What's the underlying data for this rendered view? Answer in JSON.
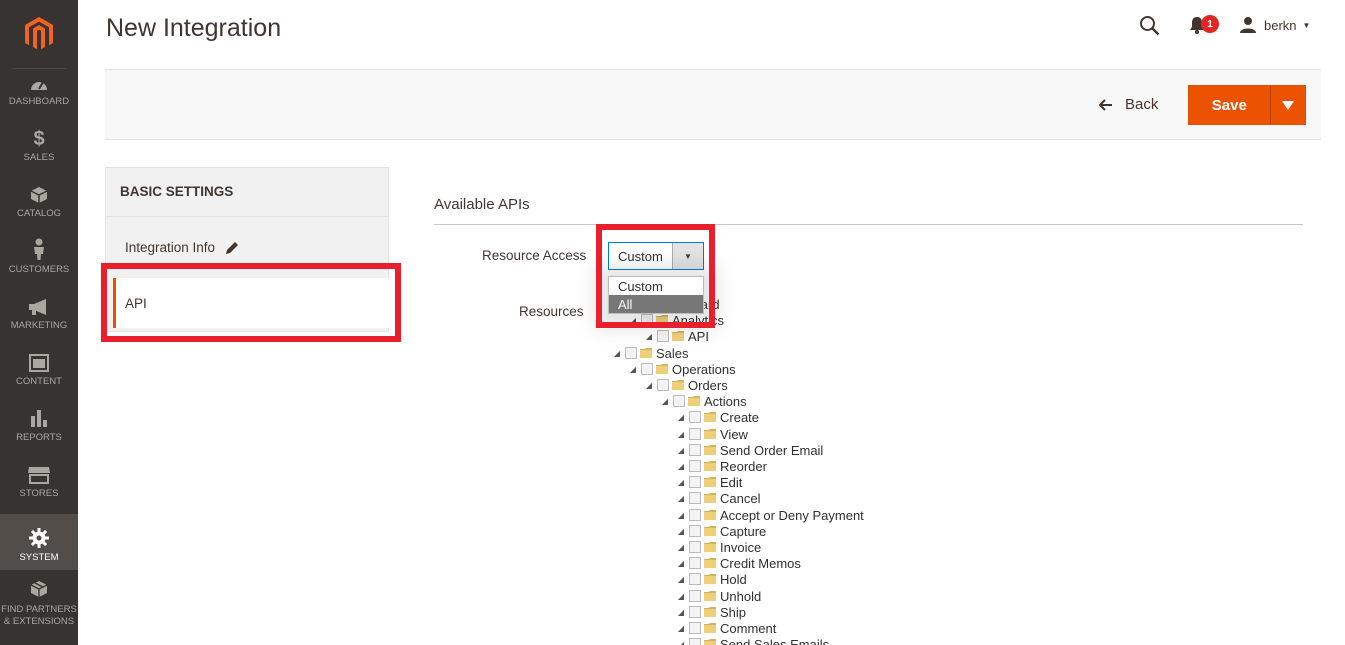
{
  "nav": {
    "items": [
      {
        "label": "DASHBOARD",
        "icon": "dashboard-icon"
      },
      {
        "label": "SALES",
        "icon": "dollar-icon"
      },
      {
        "label": "CATALOG",
        "icon": "cube-icon"
      },
      {
        "label": "CUSTOMERS",
        "icon": "person-icon"
      },
      {
        "label": "MARKETING",
        "icon": "megaphone-icon"
      },
      {
        "label": "CONTENT",
        "icon": "layout-icon"
      },
      {
        "label": "REPORTS",
        "icon": "bar-chart-icon"
      },
      {
        "label": "STORES",
        "icon": "store-icon"
      },
      {
        "label": "SYSTEM",
        "icon": "gear-icon"
      },
      {
        "label": "FIND PARTNERS & EXTENSIONS",
        "icon": "boxes-icon"
      }
    ]
  },
  "header": {
    "title": "New Integration",
    "notification_count": "1",
    "username": "berkn"
  },
  "actions": {
    "back_label": "Back",
    "save_label": "Save"
  },
  "tabs": {
    "title": "BASIC SETTINGS",
    "items": [
      {
        "label": "Integration Info"
      },
      {
        "label": "API"
      }
    ]
  },
  "content": {
    "section_title": "Available APIs",
    "resource_access_label": "Resource Access",
    "resource_access_value": "Custom",
    "dropdown_options": [
      "Custom",
      "All"
    ],
    "resources_label": "Resources",
    "tree": [
      {
        "label": "Dashboard",
        "level": 0
      },
      {
        "label": "Analytics",
        "level": 1
      },
      {
        "label": "API",
        "level": 2
      },
      {
        "label": "Sales",
        "level": 0
      },
      {
        "label": "Operations",
        "level": 1
      },
      {
        "label": "Orders",
        "level": 2
      },
      {
        "label": "Actions",
        "level": 3
      },
      {
        "label": "Create",
        "level": 4
      },
      {
        "label": "View",
        "level": 4
      },
      {
        "label": "Send Order Email",
        "level": 4
      },
      {
        "label": "Reorder",
        "level": 4
      },
      {
        "label": "Edit",
        "level": 4
      },
      {
        "label": "Cancel",
        "level": 4
      },
      {
        "label": "Accept or Deny Payment",
        "level": 4
      },
      {
        "label": "Capture",
        "level": 4
      },
      {
        "label": "Invoice",
        "level": 4
      },
      {
        "label": "Credit Memos",
        "level": 4
      },
      {
        "label": "Hold",
        "level": 4
      },
      {
        "label": "Unhold",
        "level": 4
      },
      {
        "label": "Ship",
        "level": 4
      },
      {
        "label": "Comment",
        "level": 4
      },
      {
        "label": "Send Sales Emails",
        "level": 4
      }
    ]
  },
  "colors": {
    "accent": "#eb5202",
    "nav_bg": "#373330",
    "highlight": "#e8202e"
  }
}
